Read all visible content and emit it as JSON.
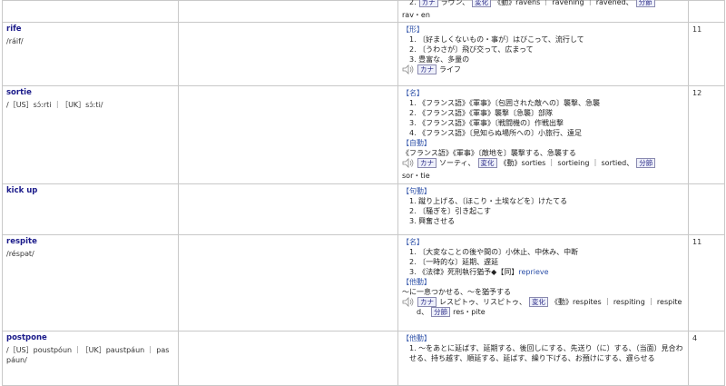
{
  "rows": [
    {
      "word": "",
      "pron": "",
      "tail": "2.",
      "kana_label": "カナ",
      "kana_value": "ラヴン、",
      "henka_label": "変化",
      "forms": "《動》ravens ｜ ravening ｜ ravened、",
      "bunsetsu_label": "分節",
      "bunsetsu_value": "rav・en",
      "num": ""
    },
    {
      "word": "rife",
      "pron": "/ráif/",
      "pos": "【形】",
      "senses": [
        "1. 〔好ましくないもの・事が〕はびこって、流行して",
        "2. 〔うわさが〕飛び交って、広まって",
        "3. 豊富な、多量の"
      ],
      "kana_label": "カナ",
      "kana_value": "ライフ",
      "num": "11"
    },
    {
      "word": "sortie",
      "pron": "/［US］sɔ́ːrti ｜［UK］sɔ́ːti/",
      "pos": "【名】",
      "senses": [
        "1. 《フランス語》《軍事》〔包囲された敵への〕襲撃、急襲",
        "2. 《フランス語》《軍事》襲撃〔急襲〕部隊",
        "3. 《フランス語》《軍事》〔戦闘機の〕作戦出撃",
        "4. 《フランス語》〔見知らぬ場所への〕小旅行、遠足"
      ],
      "pos2": "【自動】",
      "line2": "《フランス語》《軍事》〔敵地を〕襲撃する、急襲する",
      "kana_label": "カナ",
      "kana_value": "ソーティ、",
      "henka_label": "変化",
      "forms": "《動》sorties ｜ sortieing ｜ sortied、",
      "bunsetsu_label": "分節",
      "bunsetsu_value": "sor・tie",
      "num": "12"
    },
    {
      "word": "kick up",
      "pos": "【句動】",
      "senses": [
        "1. 蹴り上げる、〔ほこり・土埃などを〕けたてる",
        "2. 〔騒ぎを〕引き起こす",
        "3. 興奮させる"
      ],
      "num": ""
    },
    {
      "word": "respite",
      "pron": "/réspət/",
      "pos": "【名】",
      "senses": [
        "1. 〔大変なことの後や間の〕小休止、中休み、中断",
        "2. 〔一時的な〕延期、遅延",
        "3. 《法律》死刑執行猶予◆【同】"
      ],
      "reprieve": "reprieve",
      "pos2": "【他動】",
      "line2": "～に一息つかせる、～を猶予する",
      "kana_label": "カナ",
      "kana_value": "レスピトゥ、リスピトゥ、",
      "henka_label": "変化",
      "forms": "《動》respites ｜ respiting ｜ respite",
      "forms2": "d、",
      "bunsetsu_label": "分節",
      "bunsetsu_value": "res・pite",
      "num": "11"
    },
    {
      "word": "postpone",
      "pron": "/［US］poustpóun ｜［UK］paustpáun ｜ pas",
      "pron2": "páun/",
      "pos": "【他動】",
      "sense_text": "1. ～をあとに延ばす、延期する、後回しにする、先送り（に）する、（当面）見合わせる、持ち越す、順延する、延ばす、繰り下げる、お預けにする、遅らせる",
      "num": "4"
    }
  ]
}
